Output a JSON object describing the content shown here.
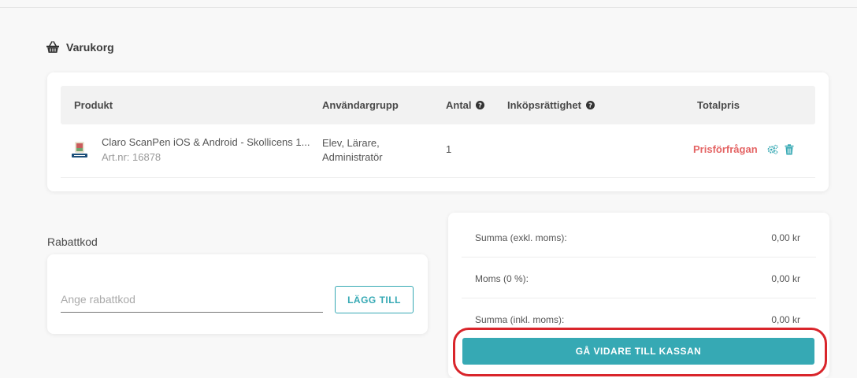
{
  "cart": {
    "title": "Varukorg",
    "columns": {
      "product": "Produkt",
      "user_group": "Användargrupp",
      "quantity": "Antal",
      "purchase_right": "Inköpsrättighet",
      "total_price": "Totalpris"
    },
    "items": [
      {
        "name": "Claro ScanPen iOS & Android - Skollicens 1...",
        "art_nr": "Art.nr: 16878",
        "user_group_line1": "Elev, Lärare,",
        "user_group_line2": "Administratör",
        "quantity": "1",
        "price": "Prisförfrågan"
      }
    ]
  },
  "discount": {
    "label": "Rabattkod",
    "placeholder": "Ange rabattkod",
    "button": "LÄGG TILL"
  },
  "summary": {
    "rows": [
      {
        "label": "Summa (exkl. moms):",
        "value": "0,00 kr"
      },
      {
        "label": "Moms (0 %):",
        "value": "0,00 kr"
      },
      {
        "label": "Summa (inkl. moms):",
        "value": "0,00 kr"
      }
    ],
    "checkout_button": "GÅ VIDARE TILL KASSAN"
  },
  "colors": {
    "accent": "#36a9b4",
    "price_request": "#e46464",
    "highlight": "#d9252b"
  },
  "icons": {
    "heading": "basket-icon",
    "info": "question-circle-icon",
    "settings": "gears-icon",
    "delete": "trash-icon"
  }
}
